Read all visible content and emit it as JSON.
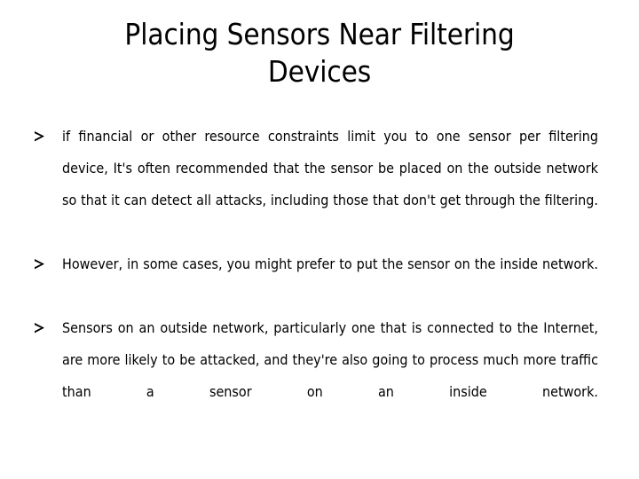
{
  "slide": {
    "background_color": "#ffffff",
    "text_color": "#000000",
    "title": {
      "line1": "Placing Sensors Near Filtering",
      "line2": "Devices"
    },
    "bullets": [
      {
        "marker": "arrowhead-bullet",
        "text": "if financial or other resource constraints limit you to one sensor per filtering device, It's often recommended that the sensor be placed on the outside network so that it can detect all attacks, including those that don't get through the filtering."
      },
      {
        "marker": "arrowhead-bullet",
        "text": "However, in some cases, you might prefer to put the sensor on the inside network."
      },
      {
        "marker": "arrowhead-bullet",
        "text": "Sensors on an outside network, particularly one that is connected to the Internet, are more likely to be attacked, and they're also going to process much more traffic than a sensor on an inside network."
      }
    ]
  }
}
